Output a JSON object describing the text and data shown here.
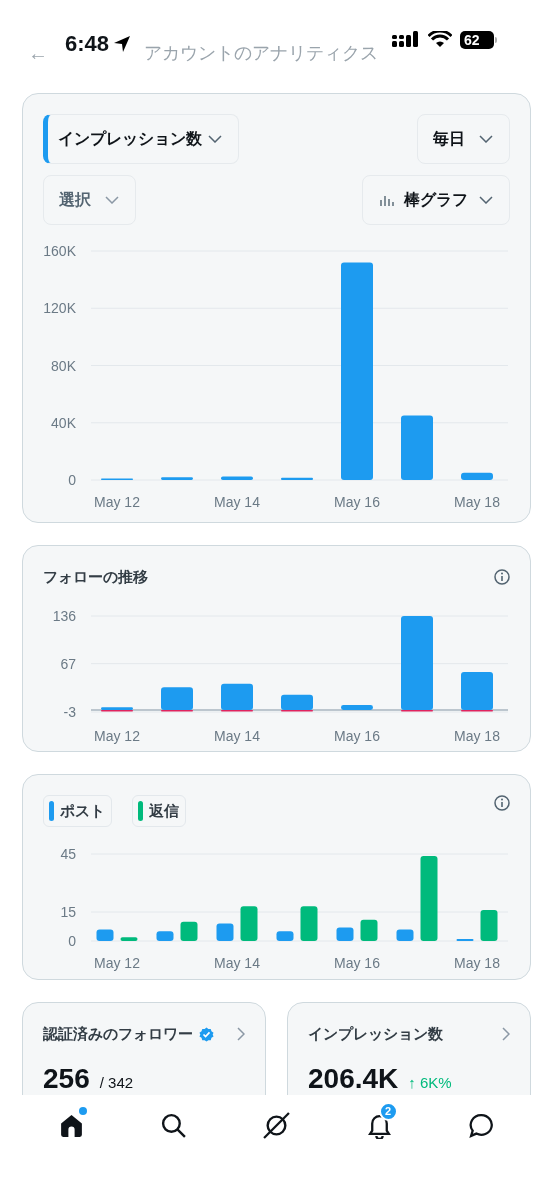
{
  "status_bar": {
    "time": "6:48",
    "battery": "62"
  },
  "header": {
    "back": "←",
    "title": "アカウントのアナリティクス"
  },
  "impressions_card": {
    "metric": "インプレッション数",
    "period": "毎日",
    "compare": "選択",
    "chart_type": "棒グラフ",
    "chart_data": {
      "type": "bar",
      "grid": true,
      "categories": [
        "May 12",
        null,
        "May 14",
        null,
        "May 16",
        null,
        "May 18"
      ],
      "ylim": [
        0,
        160000
      ],
      "yticks": [
        {
          "value": 0,
          "label": "0"
        },
        {
          "value": 40000,
          "label": "40K"
        },
        {
          "value": 80000,
          "label": "80K"
        },
        {
          "value": 120000,
          "label": "120K"
        },
        {
          "value": 160000,
          "label": "160K"
        }
      ],
      "series": [
        {
          "color": "#1d9bf0",
          "values": [
            1000,
            2000,
            2500,
            1500,
            152000,
            45000,
            5000
          ]
        }
      ]
    }
  },
  "follows_card": {
    "title": "フォローの推移",
    "chart_data": {
      "type": "bar",
      "grid": true,
      "stacked": true,
      "categories": [
        "May 12",
        null,
        "May 14",
        null,
        "May 16",
        null,
        "May 18"
      ],
      "ylim": [
        -3,
        136
      ],
      "yticks": [
        -3,
        67,
        136
      ],
      "series": [
        {
          "color": "#1d9bf0",
          "values": [
            4,
            33,
            38,
            22,
            7,
            136,
            55
          ]
        },
        {
          "color": "#e0245e",
          "values": [
            -2,
            -2,
            -1,
            -1,
            0,
            -1,
            -1
          ]
        }
      ]
    }
  },
  "posts_card": {
    "legend": [
      {
        "label": "ポスト",
        "color": "#1d9bf0"
      },
      {
        "label": "返信",
        "color": "#00ba7c"
      }
    ],
    "chart_data": {
      "type": "bar",
      "grid": true,
      "stacked": false,
      "categories": [
        "May 12",
        null,
        "May 14",
        null,
        "May 16",
        null,
        "May 18"
      ],
      "ylim": [
        0,
        45
      ],
      "yticks": [
        0,
        15,
        45
      ],
      "series": [
        {
          "color": "#1d9bf0",
          "values": [
            6,
            5,
            9,
            5,
            7,
            6,
            1
          ]
        },
        {
          "color": "#00ba7c",
          "values": [
            2,
            10,
            18,
            18,
            11,
            44,
            16
          ]
        }
      ]
    }
  },
  "stats": [
    {
      "title": "認証済みのフォロワー",
      "verified": true,
      "value": "256",
      "total": "/ 342"
    },
    {
      "title": "インプレッション数",
      "verified": false,
      "value": "206.4K",
      "change": "↑ 6K%"
    }
  ],
  "tab_bar": [
    {
      "kind": "home",
      "selected": true,
      "dot": true
    },
    {
      "kind": "search",
      "selected": false,
      "dot": false
    },
    {
      "kind": "grok",
      "selected": false,
      "dot": false
    },
    {
      "kind": "notifications",
      "selected": false,
      "dot": false,
      "badge": "2"
    },
    {
      "kind": "messages",
      "selected": false,
      "dot": false
    }
  ]
}
